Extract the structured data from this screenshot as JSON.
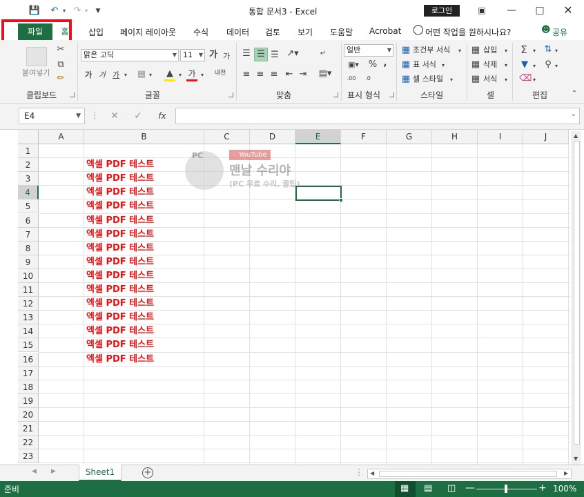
{
  "titlebar": {
    "title": "통합 문서3  -  Excel",
    "login": "로그인"
  },
  "tabs": {
    "file": "파일",
    "home": "홈",
    "items": [
      "삽입",
      "페이지 레이아웃",
      "수식",
      "데이터",
      "검토",
      "보기",
      "도움말",
      "Acrobat"
    ],
    "tellme": "어떤 작업을 원하시나요?",
    "share": "공유"
  },
  "ribbon": {
    "clipboard": {
      "label": "클립보드",
      "paste": "붙여넣기"
    },
    "font": {
      "label": "글꼴",
      "name": "맑은 고딕",
      "size": "11",
      "bold": "가",
      "italic": "가",
      "underline": "가"
    },
    "align": {
      "label": "맞춤"
    },
    "number": {
      "label": "표시 형식",
      "format": "일반"
    },
    "styles": {
      "label": "스타일",
      "cond": "조건부 서식",
      "table": "표 서식",
      "cell": "셀 스타일"
    },
    "cells": {
      "label": "셀",
      "insert": "삽입",
      "delete": "삭제",
      "format": "서식"
    },
    "editing": {
      "label": "편집"
    }
  },
  "formula": {
    "namebox": "E4",
    "fx": "fx"
  },
  "grid": {
    "columns": [
      "A",
      "B",
      "C",
      "D",
      "E",
      "F",
      "G",
      "H",
      "I",
      "J"
    ],
    "rows": [
      "1",
      "2",
      "3",
      "4",
      "5",
      "6",
      "7",
      "8",
      "9",
      "10",
      "11",
      "12",
      "13",
      "14",
      "15",
      "16",
      "17",
      "18",
      "19",
      "20",
      "21",
      "22",
      "23"
    ],
    "cell_text": [
      "엑셀 PDF 테스트",
      "엑셀 PDF 테스트",
      "엑셀 PDF 테스트",
      "엑셀 PDF 테스트",
      "엑셀 PDF 테스트",
      "엑셀 PDF 테스트",
      "엑셀 PDF 테스트",
      "엑셀 PDF 테스트",
      "엑셀 PDF 테스트",
      "엑셀 PDF 테스트",
      "엑셀 PDF 테스트",
      "엑셀 PDF 테스트",
      "엑셀 PDF 테스트",
      "엑셀 PDF 테스트",
      "엑셀 PDF 테스트"
    ],
    "text_color": "#ee1010"
  },
  "watermark": {
    "pc": "PC",
    "youtube": "YouTube",
    "name": "맨날 수리야",
    "sub": "(PC 무료 수리, 꿀팁)"
  },
  "sheets": {
    "active": "Sheet1"
  },
  "status": {
    "ready": "준비",
    "zoom": "100%"
  },
  "colors": {
    "excel_green": "#1e6e43",
    "highlight_red": "#e8131a"
  }
}
